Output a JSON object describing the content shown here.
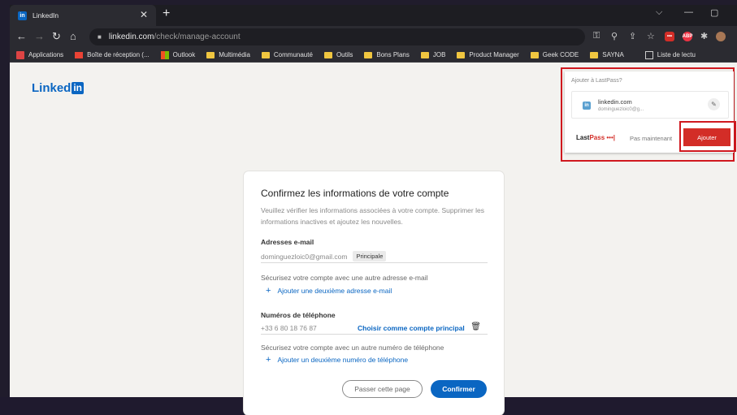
{
  "browser": {
    "tab_title": "LinkedIn",
    "tab_close": "✕",
    "new_tab": "+",
    "url_host": "linkedin.com",
    "url_path": "/check/manage-account",
    "window_controls": [
      "⌵",
      "—",
      "▢"
    ]
  },
  "bookmarks": [
    {
      "label": "Applications",
      "icon": "apps-icon",
      "color": "#d44"
    },
    {
      "label": "Boîte de réception (...",
      "icon": "gmail-icon",
      "color": "#ea4335"
    },
    {
      "label": "Outlook",
      "icon": "microsoft-icon",
      "color": "#f25022"
    },
    {
      "label": "Multimédia",
      "icon": "folder-icon",
      "color": "#f0c640"
    },
    {
      "label": "Communauté",
      "icon": "folder-icon",
      "color": "#f0c640"
    },
    {
      "label": "Outils",
      "icon": "folder-icon",
      "color": "#f0c640"
    },
    {
      "label": "Bons Plans",
      "icon": "folder-icon",
      "color": "#f0c640"
    },
    {
      "label": "JOB",
      "icon": "folder-icon",
      "color": "#f0c640"
    },
    {
      "label": "Product Manager",
      "icon": "folder-icon",
      "color": "#f0c640"
    },
    {
      "label": "Geek CODE",
      "icon": "folder-icon",
      "color": "#f0c640"
    },
    {
      "label": "SAYNA",
      "icon": "folder-icon",
      "color": "#f0c640"
    },
    {
      "label": "Liste de lectu",
      "icon": "reading-list-icon",
      "color": "#ccc"
    }
  ],
  "page": {
    "logo_text": "Linked",
    "logo_in": "in",
    "card": {
      "title": "Confirmez les informations de votre compte",
      "description": "Veuillez vérifier les informations associées à votre compte. Supprimer les informations inactives et ajoutez les nouvelles.",
      "email_section": "Adresses e-mail",
      "email_value": "dominguezloic0@gmail.com",
      "email_badge": "Principale",
      "email_note": "Sécurisez votre compte avec une autre adresse e-mail",
      "add_email": "Ajouter une deuxième adresse e-mail",
      "phone_section": "Numéros de téléphone",
      "phone_value": "+33 6 80 18 76 87",
      "phone_primary_link": "Choisir comme compte principal",
      "phone_note": "Sécurisez votre compte avec un autre numéro de téléphone",
      "add_phone": "Ajouter un deuxième numéro de téléphone",
      "skip_button": "Passer cette page",
      "confirm_button": "Confirmer"
    }
  },
  "lastpass": {
    "title": "Ajouter à LastPass?",
    "site": "linkedin.com",
    "user": "dominguezloic0@g...",
    "brand_prefix": "Last",
    "brand_suffix": "Pass",
    "brand_dots": "•••|",
    "later": "Pas maintenant",
    "add_button": "Ajouter"
  }
}
